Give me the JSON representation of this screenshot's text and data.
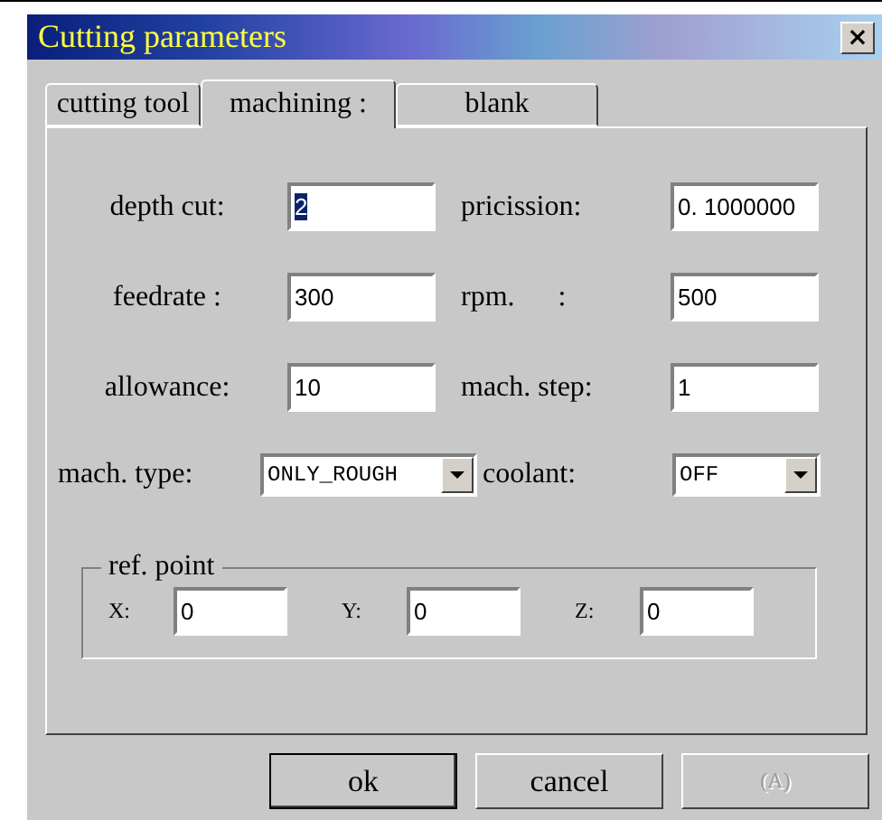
{
  "window": {
    "title": "Cutting parameters",
    "close": "×"
  },
  "tabs": [
    {
      "label": "cutting tool",
      "selected": false
    },
    {
      "label": "machining :",
      "selected": true
    },
    {
      "label": "blank",
      "selected": false
    }
  ],
  "fields": [
    {
      "label": "depth cut:",
      "kind": "text",
      "value": "2",
      "focused": true
    },
    {
      "label": "pricission:",
      "kind": "text",
      "value": "0. 1000000",
      "focused": false
    },
    {
      "label": "feedrate :",
      "kind": "text",
      "value": "300",
      "focused": false
    },
    {
      "label": "rpm.      :",
      "kind": "text",
      "value": "500",
      "focused": false
    },
    {
      "label": "allowance:",
      "kind": "text",
      "value": "10",
      "focused": false
    },
    {
      "label": "mach. step:",
      "kind": "text",
      "value": "1",
      "focused": false
    },
    {
      "label": "mach. type:",
      "kind": "select",
      "value": "ONLY_ROUGH"
    },
    {
      "label": "coolant:",
      "kind": "select",
      "value": "OFF"
    }
  ],
  "ref_point": {
    "title": "ref. point",
    "coords": [
      {
        "label": "X:",
        "value": "0"
      },
      {
        "label": "Y:",
        "value": "0"
      },
      {
        "label": "Z:",
        "value": "0"
      }
    ]
  },
  "buttons": [
    {
      "label": "ok",
      "default": true,
      "disabled": false
    },
    {
      "label": "cancel",
      "default": false,
      "disabled": false
    },
    {
      "label": "(A)",
      "default": false,
      "disabled": true
    }
  ]
}
